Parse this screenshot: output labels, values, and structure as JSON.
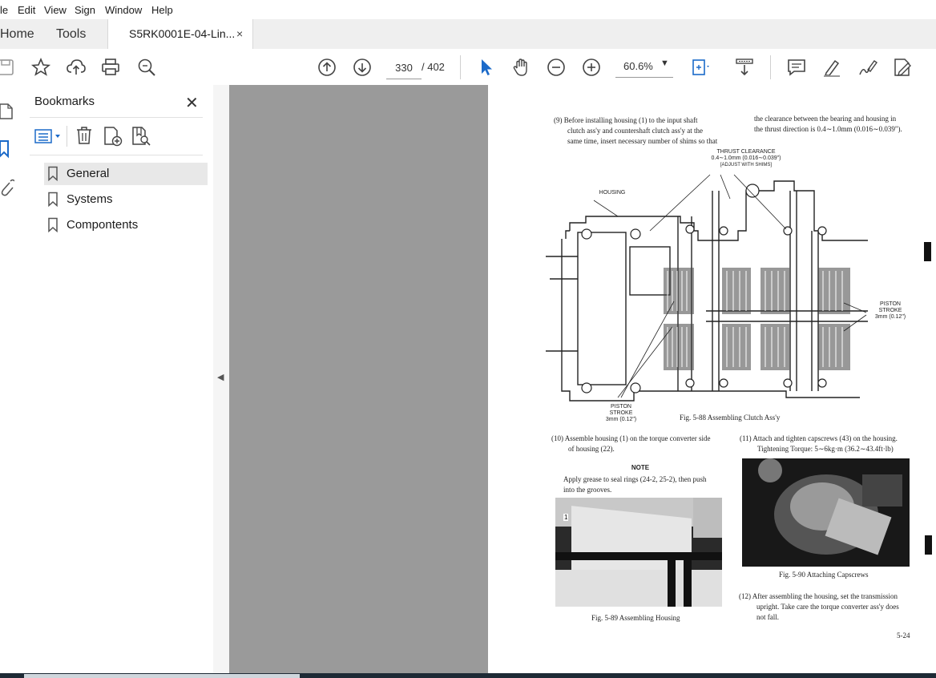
{
  "menu": [
    "le",
    "Edit",
    "View",
    "Sign",
    "Window",
    "Help"
  ],
  "tabs": {
    "home": "Home",
    "tools": "Tools",
    "document": "S5RK0001E-04-Lin...",
    "close": "×"
  },
  "toolbar": {
    "page_current": "330",
    "page_total": "/ 402",
    "zoom": "60.6%"
  },
  "icons": [
    "save-icon",
    "star-icon",
    "upload-cloud-icon",
    "print-icon",
    "search-zoom-icon",
    "arrow-up-circle-icon",
    "arrow-down-circle-icon",
    "select-arrow-icon",
    "hand-icon",
    "zoom-out-icon",
    "zoom-in-icon",
    "fit-page-icon",
    "scroll-mode-icon",
    "comment-icon",
    "highlight-icon",
    "sign-icon",
    "fill-sign-icon"
  ],
  "bookmarks": {
    "title": "Bookmarks",
    "close": "✕",
    "items": [
      {
        "label": "General"
      },
      {
        "label": "Systems"
      },
      {
        "label": "Compontents"
      }
    ]
  },
  "document_page": {
    "step9_left": [
      "(9)  Before  installing  housing (1)  to  the  input  shaft",
      "clutch  ass'y  and  countershaft  clutch  ass'y  at  the",
      "same time, insert necessary number of shims so that"
    ],
    "step9_right": [
      "the clearance between the bearing and housing in",
      "the thrust direction is 0.4∼1.0mm (0.016∼0.039\")."
    ],
    "thrust_label": [
      "THRUST CLEARANCE",
      "0.4∼1.0mm (0.016∼0.039\")",
      "[ADJUST WITH SHIMS]"
    ],
    "housing_label": "HOUSING",
    "piston_right": [
      "PISTON",
      "STROKE",
      "3mm (0.12\")"
    ],
    "piston_bottom": [
      "PISTON",
      "STROKE",
      "3mm (0.12\")"
    ],
    "fig88": "Fig. 5-88   Assembling Clutch Ass'y",
    "step10": [
      "(10)  Assemble housing (1) on the torque converter side",
      "of housing (22)."
    ],
    "note_title": "NOTE",
    "note_text": [
      "Apply grease to seal rings (24-2, 25-2), then push",
      "into the grooves."
    ],
    "fig89": "Fig. 5-89   Assembling Housing",
    "step11": [
      "(11)  Attach and tighten capscrews (43) on the housing.",
      "Tightening Torque:  5∼6kg·m (36.2∼43.4ft·lb)"
    ],
    "fig90": "Fig. 5-90   Attaching Capscrews",
    "step12": [
      "(12)  After assembling the housing, set the transmission",
      "upright.  Take care the torque converter ass'y does",
      "not fall."
    ],
    "page_number": "5-24"
  }
}
